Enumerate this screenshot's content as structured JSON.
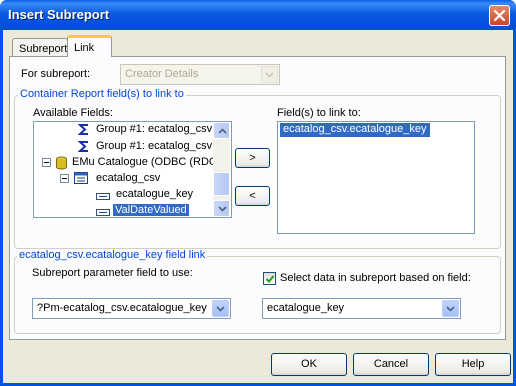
{
  "window": {
    "title": "Insert Subreport"
  },
  "tabs": [
    {
      "label": "Subreport"
    },
    {
      "label": "Link"
    }
  ],
  "for_subreport": {
    "label": "For subreport:",
    "value": "Creator Details"
  },
  "container_group": {
    "label": "Container Report field(s) to link to",
    "available_label": "Available Fields:",
    "tree_items": [
      {
        "label": "Group #1: ecatalog_csv",
        "icon": "sigma-icon"
      },
      {
        "label": "Group #1: ecatalog_csv",
        "icon": "sigma-icon"
      },
      {
        "label": "EMu Catalogue (ODBC (RDO",
        "icon": "database-icon"
      },
      {
        "label": "ecatalog_csv",
        "icon": "table-icon"
      },
      {
        "label": "ecatalogue_key",
        "icon": "field-icon"
      },
      {
        "label": "ValDateValued",
        "icon": "field-icon"
      }
    ],
    "add_button": ">",
    "remove_button": "<",
    "linked_label": "Field(s) to link to:",
    "linked_items": [
      "ecatalog_csv.ecatalogue_key"
    ]
  },
  "field_link_group": {
    "label": "ecatalog_csv.ecatalogue_key field link",
    "param_label": "Subreport parameter field to use:",
    "param_value": "?Pm-ecatalog_csv.ecatalogue_key",
    "select_data_label": "Select data in subreport based on field:",
    "select_data_checked": true,
    "field_value": "ecatalogue_key"
  },
  "buttons": {
    "ok": "OK",
    "cancel": "Cancel",
    "help": "Help"
  },
  "colors": {
    "title_bar": "#0054e3",
    "selection": "#316ac5",
    "group_label": "#0046d5",
    "dialog_bg": "#ece9d8"
  }
}
